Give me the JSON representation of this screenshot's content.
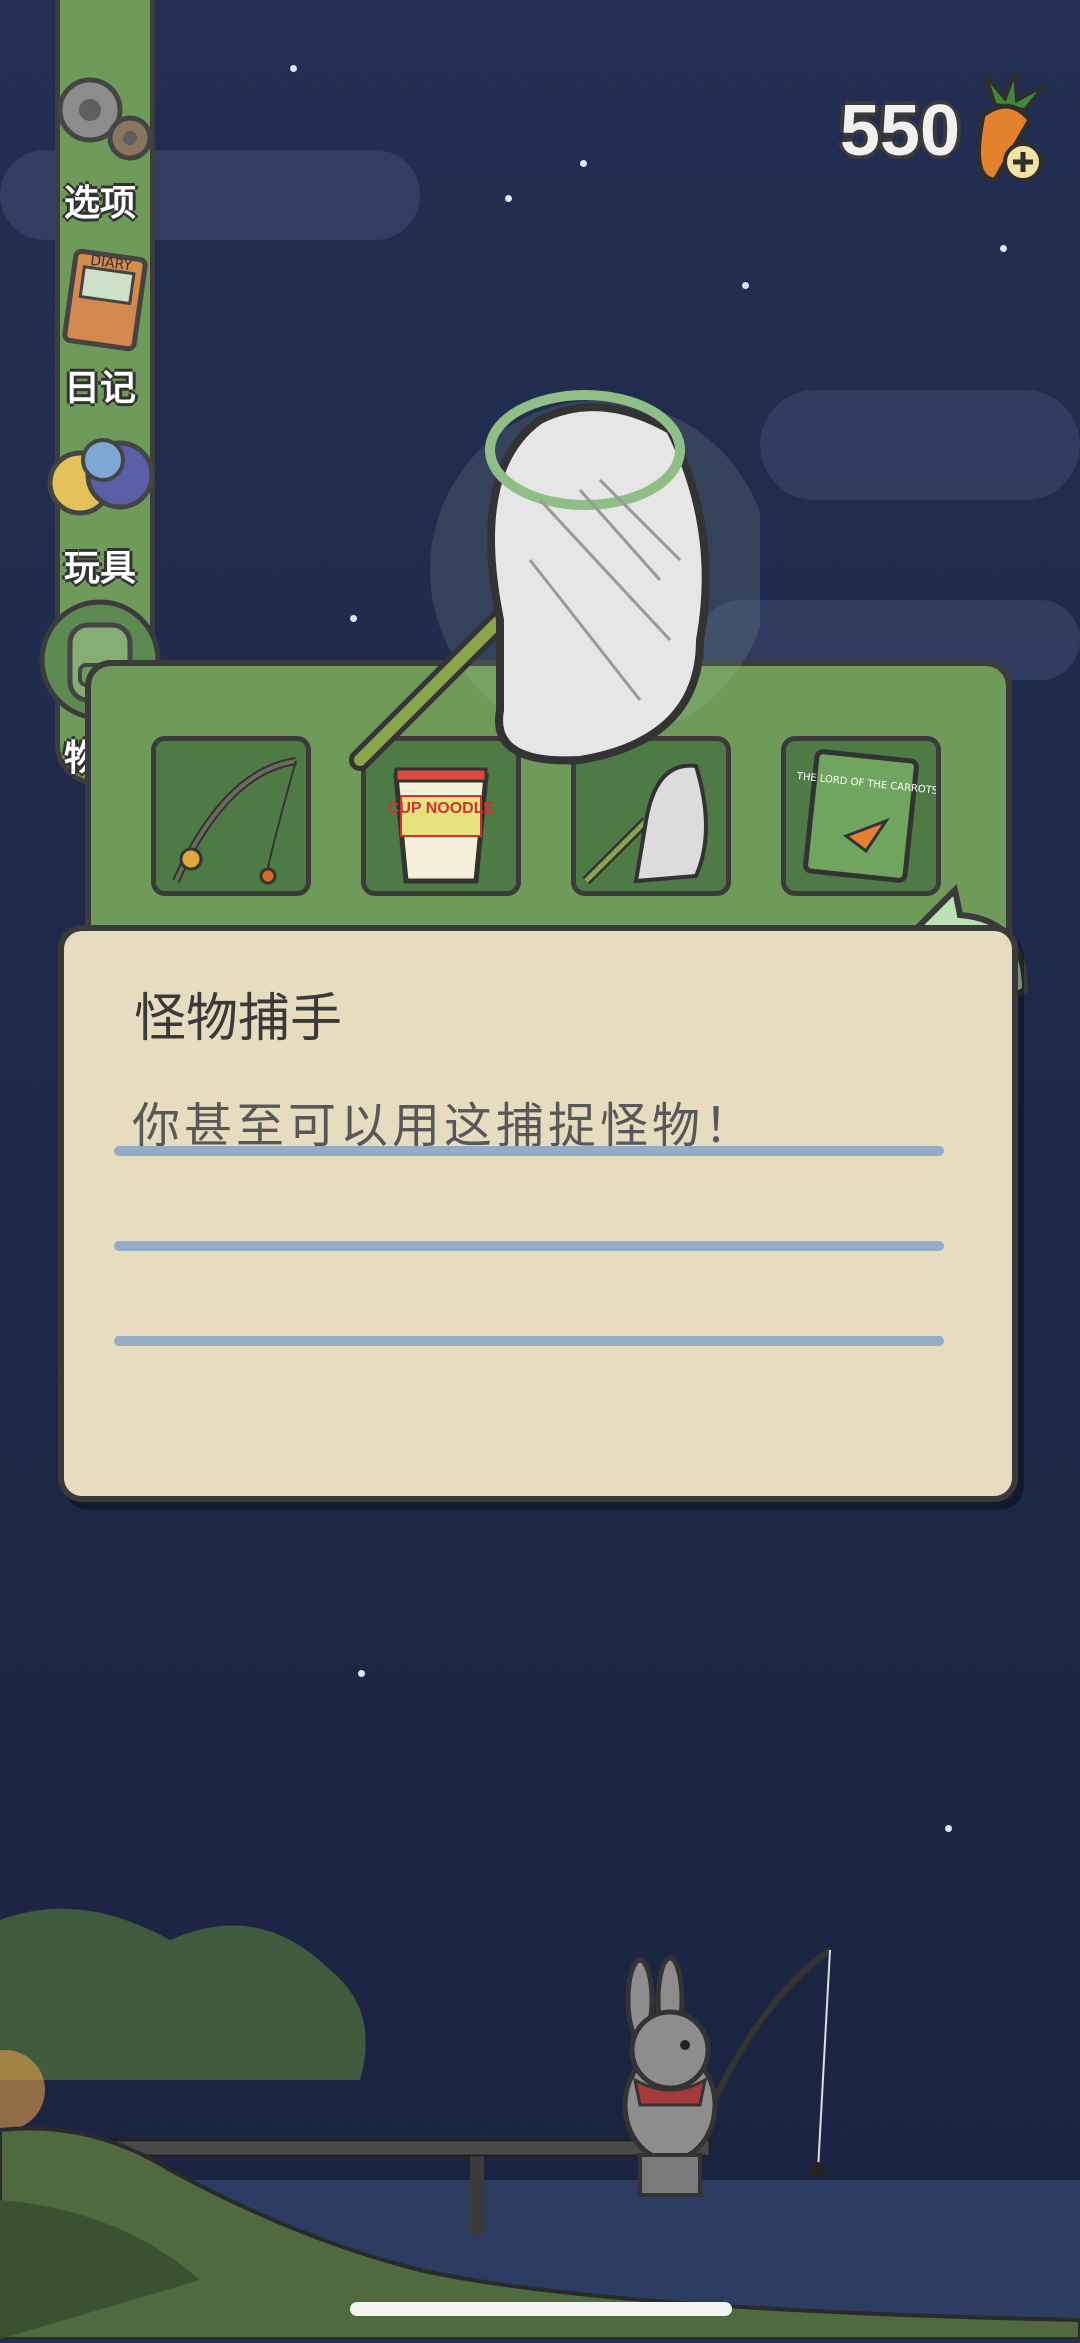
{
  "currency": {
    "amount": "550",
    "icon": "carrot-plus-icon"
  },
  "menu": {
    "items": [
      {
        "label": "选项",
        "icon": "gear-icon"
      },
      {
        "label": "日记",
        "icon": "diary-icon"
      },
      {
        "label": "玩具",
        "icon": "toy-balls-icon"
      },
      {
        "label": "物品",
        "icon": "backpack-icon"
      }
    ]
  },
  "inventory": {
    "slots": [
      {
        "item": "fishing-rod-icon"
      },
      {
        "item": "cup-noodle-icon",
        "label": "CUP NOODLE"
      },
      {
        "item": "bug-net-icon"
      },
      {
        "item": "book-icon",
        "label": "THE LORD OF THE CARROTS"
      }
    ],
    "selected_item": "bug-net-icon"
  },
  "description": {
    "title": "怪物捕手",
    "text": "你甚至可以用这捕捉怪物！"
  },
  "diary_cover_text": "DIARY",
  "colors": {
    "panel_green": "#6e9a5a",
    "card": "#e8dcc0",
    "sky": "#1f2a4b"
  }
}
